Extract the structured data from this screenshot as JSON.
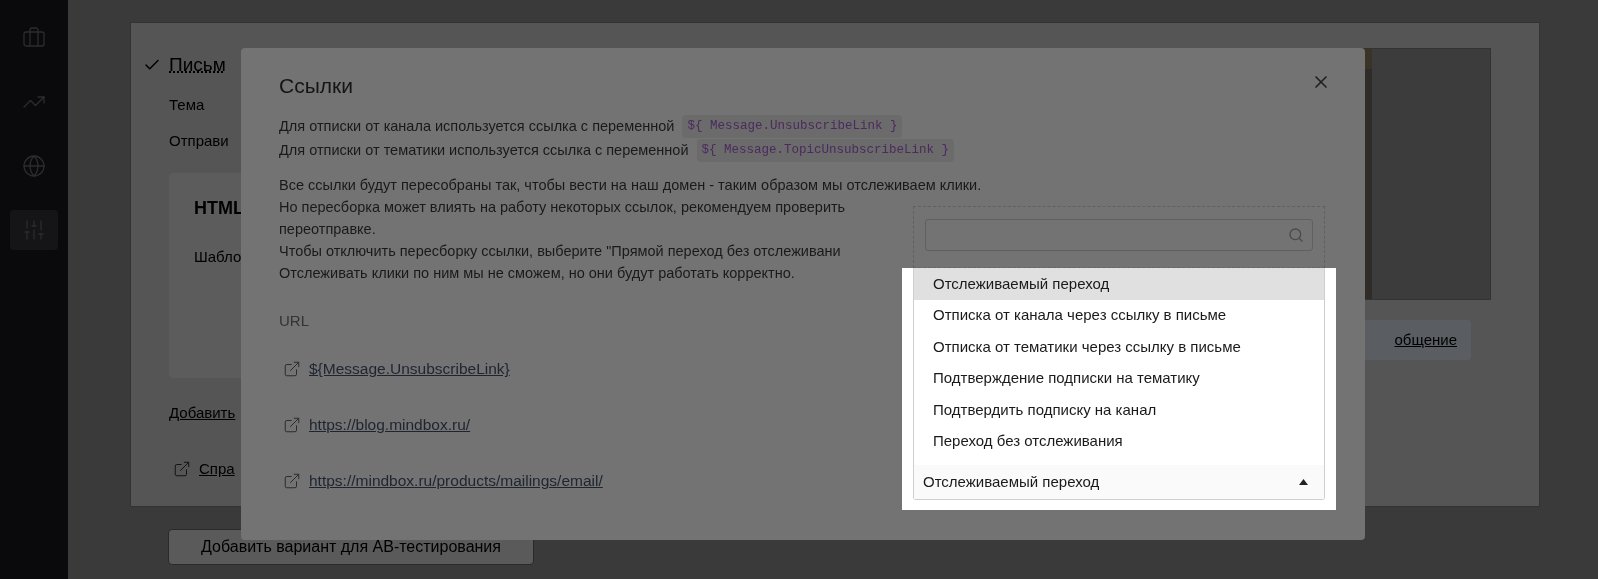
{
  "sidebar": {
    "items": [
      {
        "selected": false
      },
      {
        "selected": false
      },
      {
        "selected": false
      },
      {
        "selected": true
      }
    ]
  },
  "background": {
    "card_title": "Письм",
    "checked": true,
    "fields": [
      "Тема",
      "Отправи"
    ],
    "template_box": {
      "title": "HTML",
      "text": "Шабло"
    },
    "add_link": "Добавить",
    "help_link": "Спра",
    "preview": {
      "kind": "picture"
    },
    "message_button": "общение",
    "ab_button": "Добавить вариант для АВ-тестирования"
  },
  "dialog": {
    "title": "Ссылки",
    "intro": [
      {
        "text": "Для отписки от канала используется ссылка с переменной",
        "code": "${ Message.UnsubscribeLink }"
      },
      {
        "text": "Для отписки от тематики используется ссылка с переменной",
        "code": "${ Message.TopicUnsubscribeLink }"
      }
    ],
    "paragraph": [
      "Все ссылки будут пересобраны так, чтобы вести на наш домен - таким образом мы отслеживаем клики.",
      "Но пересборка может влиять на работу некоторых ссылок, рекомендуем проверить",
      "переотправке.",
      "Чтобы отключить пересборку ссылки, выберите \"Прямой переход без отслеживани",
      "Отслеживать клики по ним мы не сможем, но они будут работать корректно."
    ],
    "url_label": "URL",
    "links": [
      "${Message.UnsubscribeLink}",
      "https://blog.mindbox.ru/",
      "https://mindbox.ru/products/mailings/email/"
    ],
    "dropdown": {
      "expanded": true,
      "options": [
        {
          "label": "Отслеживаемый переход",
          "selected": true
        },
        {
          "label": "Отписка от канала через ссылку в письме",
          "selected": false
        },
        {
          "label": "Отписка от тематики через ссылку в письме",
          "selected": false
        },
        {
          "label": "Подтверждение подписки на тематику",
          "selected": false
        },
        {
          "label": "Подтвердить подписку на канал",
          "selected": false
        },
        {
          "label": "Переход без отслеживания",
          "selected": false
        }
      ],
      "value": "Отслеживаемый переход"
    }
  }
}
